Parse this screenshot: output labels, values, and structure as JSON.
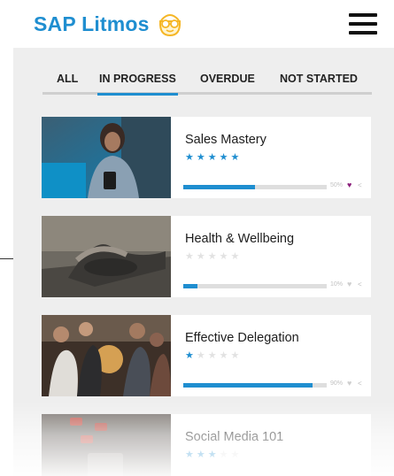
{
  "brand": {
    "name": "SAP Litmos",
    "logo_icon": "owl-glasses-icon",
    "color": "#1f8ed0"
  },
  "header": {
    "menu_icon": "hamburger-menu-icon"
  },
  "tabs": [
    {
      "label": "ALL",
      "active": false
    },
    {
      "label": "IN PROGRESS",
      "active": true
    },
    {
      "label": "OVERDUE",
      "active": false
    },
    {
      "label": "NOT STARTED",
      "active": false
    }
  ],
  "courses": [
    {
      "title": "Sales Mastery",
      "rating": 5,
      "progress_percent": 50,
      "progress_label": "50%",
      "liked": true
    },
    {
      "title": "Health & Wellbeing",
      "rating": 0,
      "progress_percent": 10,
      "progress_label": "10%",
      "liked": false
    },
    {
      "title": "Effective Delegation",
      "rating": 1,
      "progress_percent": 90,
      "progress_label": "90%",
      "liked": false
    },
    {
      "title": "Social Media 101",
      "rating": 3,
      "progress_percent": 0,
      "progress_label": "",
      "liked": false
    }
  ],
  "icons": {
    "heart": "heart-icon",
    "share": "share-icon"
  },
  "colors": {
    "accent": "#1f8ed0",
    "liked": "#8a1e7a",
    "background": "#eeeeee"
  }
}
